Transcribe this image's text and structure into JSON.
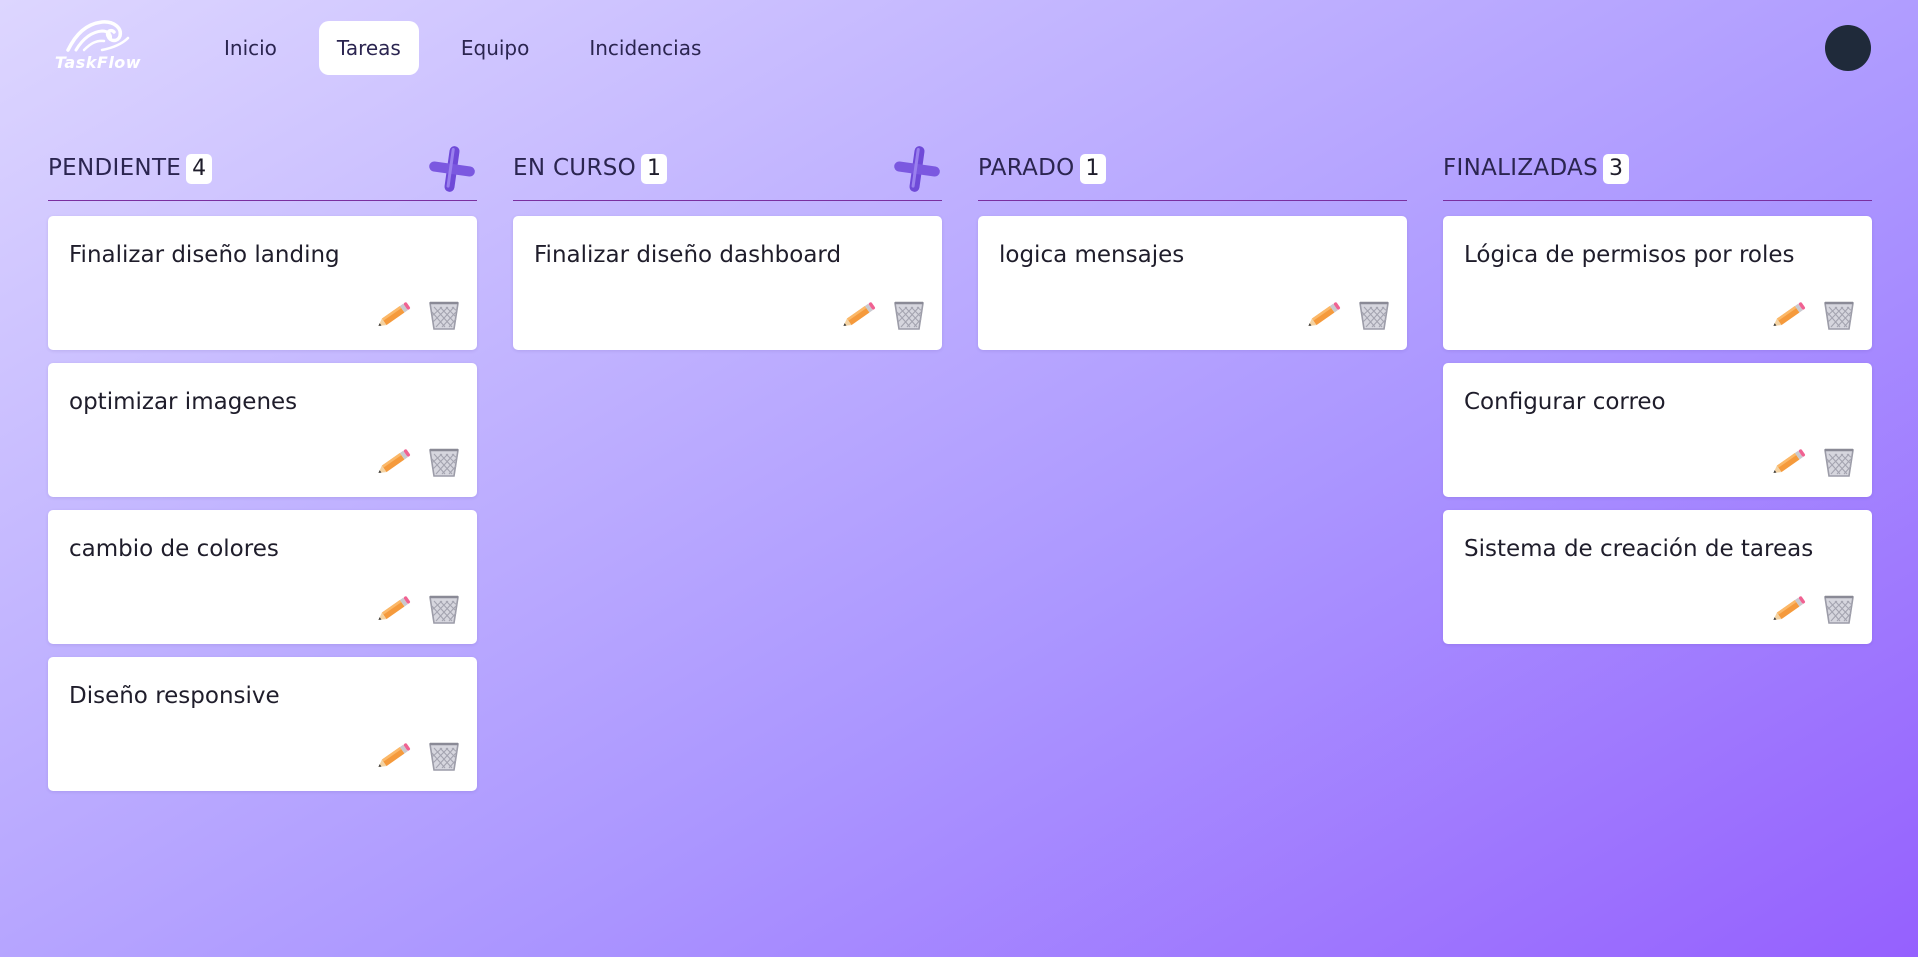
{
  "app": {
    "logo_text": "TaskFlow"
  },
  "nav": {
    "items": [
      {
        "label": "Inicio",
        "active": false
      },
      {
        "label": "Tareas",
        "active": true
      },
      {
        "label": "Equipo",
        "active": false
      },
      {
        "label": "Incidencias",
        "active": false
      }
    ]
  },
  "colors": {
    "accent": "#7a2fa0",
    "add": "#6f4ad8",
    "avatar": "#1f2a3a"
  },
  "icons": {
    "edit": "pencil-icon",
    "delete": "trash-basket-icon",
    "add": "plus-icon"
  },
  "columns": [
    {
      "title": "PENDIENTE",
      "count": "4",
      "has_add": true,
      "cards": [
        "Finalizar diseño landing",
        "optimizar imagenes",
        "cambio de colores",
        "Diseño responsive"
      ]
    },
    {
      "title": "EN CURSO",
      "count": "1",
      "has_add": true,
      "cards": [
        "Finalizar diseño dashboard"
      ]
    },
    {
      "title": "PARADO",
      "count": "1",
      "has_add": false,
      "cards": [
        "logica mensajes"
      ]
    },
    {
      "title": "FINALIZADAS",
      "count": "3",
      "has_add": false,
      "cards": [
        "Lógica de permisos por roles",
        "Configurar correo",
        "Sistema de creación de tareas"
      ]
    }
  ]
}
